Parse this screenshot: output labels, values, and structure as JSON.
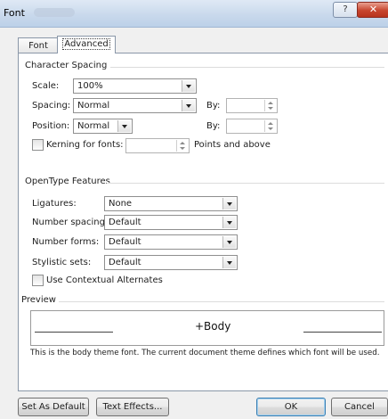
{
  "window": {
    "title": "Font"
  },
  "tabs": {
    "font": "Font",
    "advanced": "Advanced"
  },
  "character_spacing": {
    "heading": "Character Spacing",
    "scale_label": "Scale:",
    "scale_value": "100%",
    "spacing_label": "Spacing:",
    "spacing_value": "Normal",
    "spacing_by_label": "By:",
    "position_label": "Position:",
    "position_value": "Normal",
    "position_by_label": "By:",
    "kerning_label": "Kerning for fonts:",
    "kerning_suffix": "Points and above"
  },
  "opentype": {
    "heading": "OpenType Features",
    "ligatures_label": "Ligatures:",
    "ligatures_value": "None",
    "number_spacing_label": "Number spacing:",
    "number_spacing_value": "Default",
    "number_forms_label": "Number forms:",
    "number_forms_value": "Default",
    "stylistic_sets_label": "Stylistic sets:",
    "stylistic_sets_value": "Default",
    "contextual_label": "Use Contextual Alternates"
  },
  "preview": {
    "heading": "Preview",
    "sample_text": "+Body",
    "description": "This is the body theme font. The current document theme defines which font will be used."
  },
  "buttons": {
    "set_default": "Set As Default",
    "text_effects": "Text Effects...",
    "ok": "OK",
    "cancel": "Cancel"
  },
  "icons": {
    "help": "help-icon",
    "close": "close-icon"
  }
}
